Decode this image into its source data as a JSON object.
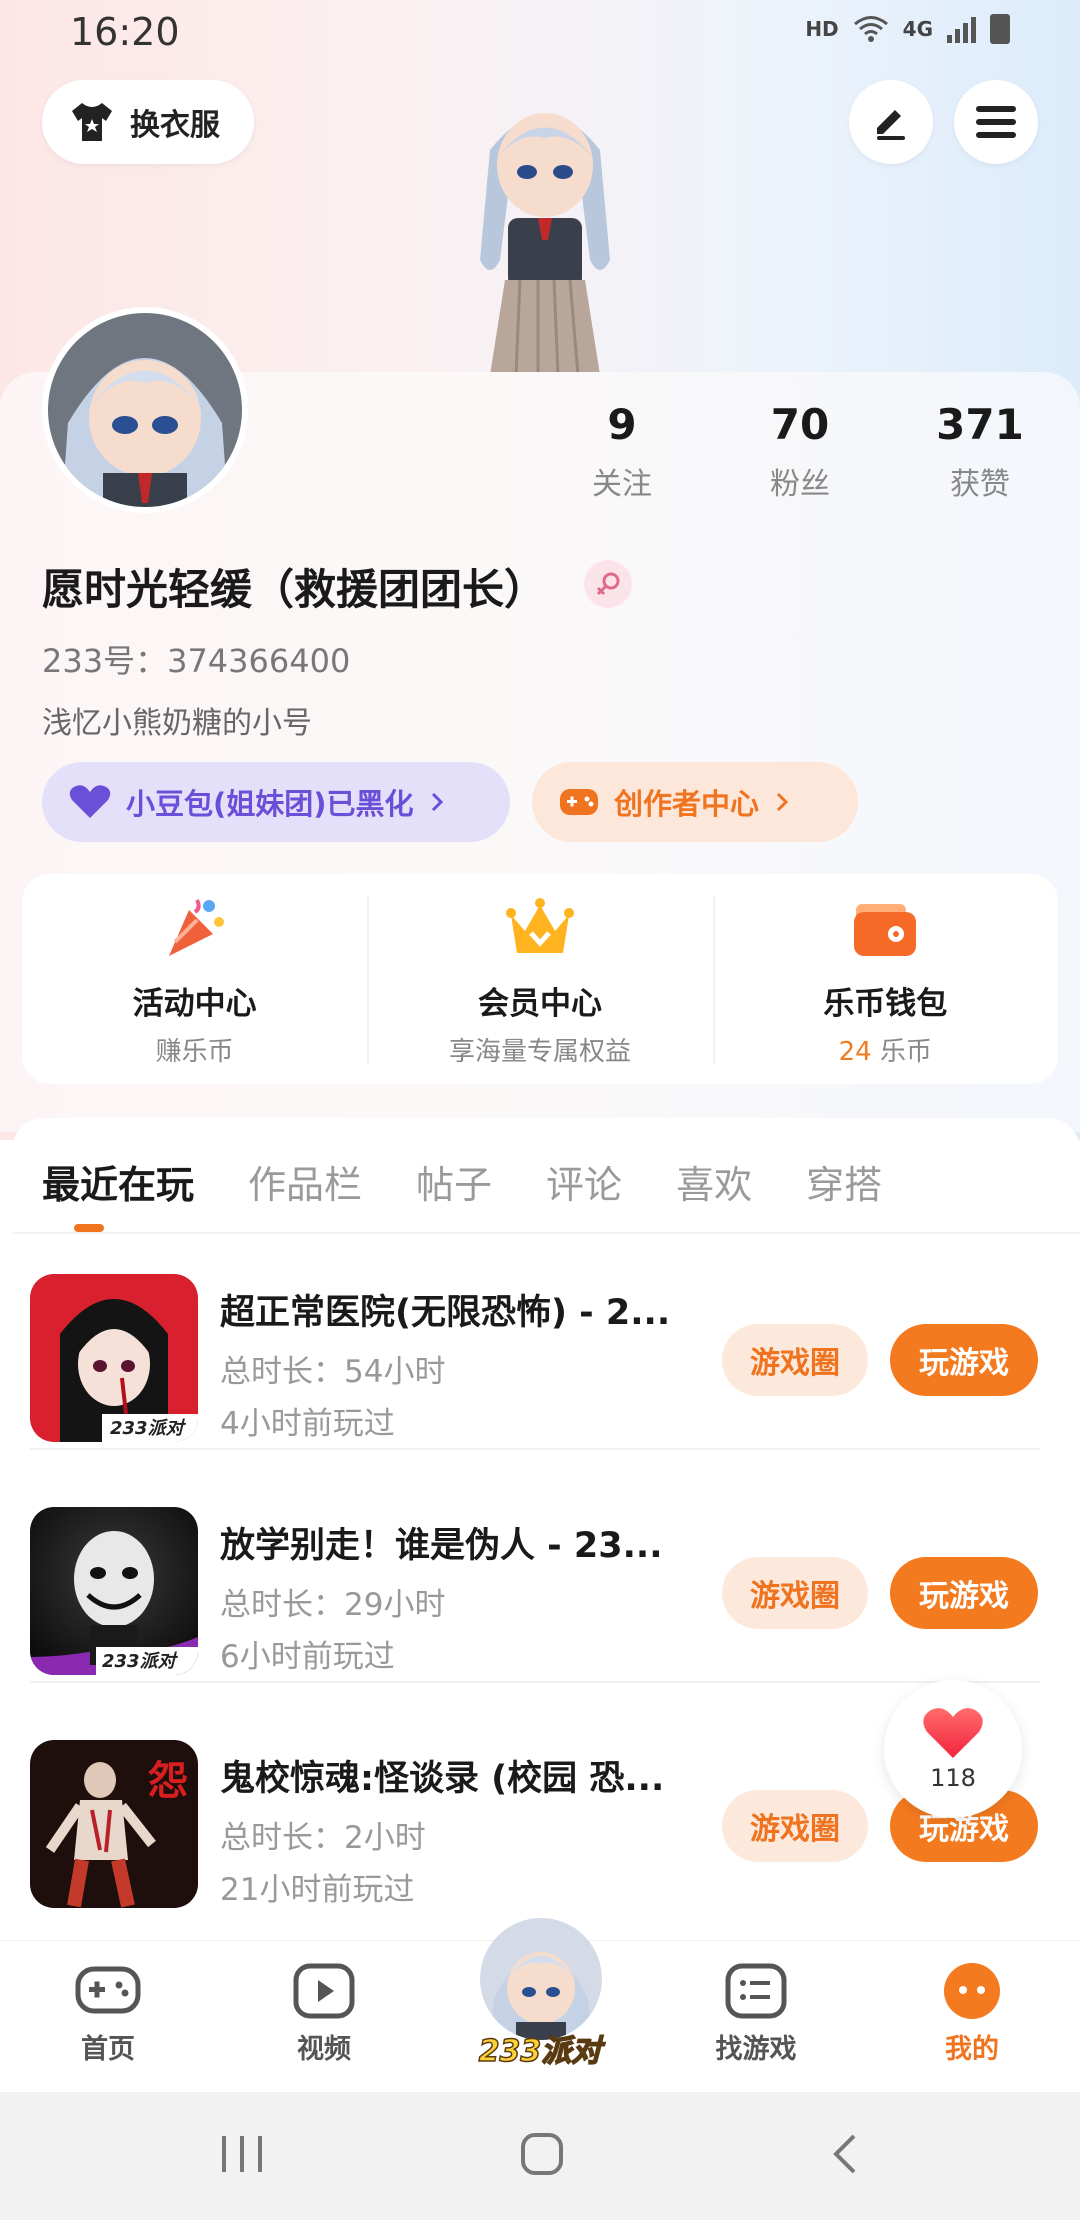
{
  "status_bar": {
    "time": "16:20",
    "hd": "HD",
    "network": "4G"
  },
  "header": {
    "change_clothes": "换衣服",
    "edit_icon": "edit-icon",
    "menu_icon": "menu-icon"
  },
  "profile": {
    "stats": [
      {
        "value": "9",
        "label": "关注"
      },
      {
        "value": "70",
        "label": "粉丝"
      },
      {
        "value": "371",
        "label": "获赞"
      }
    ],
    "nickname": "愿时光轻缓（救援团团长）",
    "uid": "233号：374366400",
    "bio": "浅忆小熊奶糖的小号",
    "pill_group": "小豆包(姐妹团)已黑化",
    "pill_creator": "创作者中心"
  },
  "features": [
    {
      "title": "活动中心",
      "sub": "赚乐币"
    },
    {
      "title": "会员中心",
      "sub": "享海量专属权益"
    },
    {
      "title": "乐币钱包",
      "sub_value": "24",
      "sub_unit": " 乐币"
    }
  ],
  "tabs": [
    "最近在玩",
    "作品栏",
    "帖子",
    "评论",
    "喜欢",
    "穿搭"
  ],
  "games": [
    {
      "title": "超正常医院(无限恐怖) - 2...",
      "duration": "总时长：54小时",
      "last_played": "4小时前玩过",
      "thumb_label": "233派对"
    },
    {
      "title": "放学别走！谁是伪人 - 23...",
      "duration": "总时长：29小时",
      "last_played": "6小时前玩过",
      "thumb_label": "233派对"
    },
    {
      "title": "鬼校惊魂:怪谈录 (校园 恐...",
      "duration": "总时长：2小时",
      "last_played": "21小时前玩过",
      "thumb_label": "怨"
    }
  ],
  "game_buttons": {
    "circle": "游戏圈",
    "play": "玩游戏"
  },
  "like_float": {
    "count": "118"
  },
  "bottom_nav": {
    "home": "首页",
    "video": "视频",
    "center": "233派对",
    "find": "找游戏",
    "mine": "我的"
  },
  "colors": {
    "accent": "#f47a1f",
    "purple": "#6a50d8"
  }
}
